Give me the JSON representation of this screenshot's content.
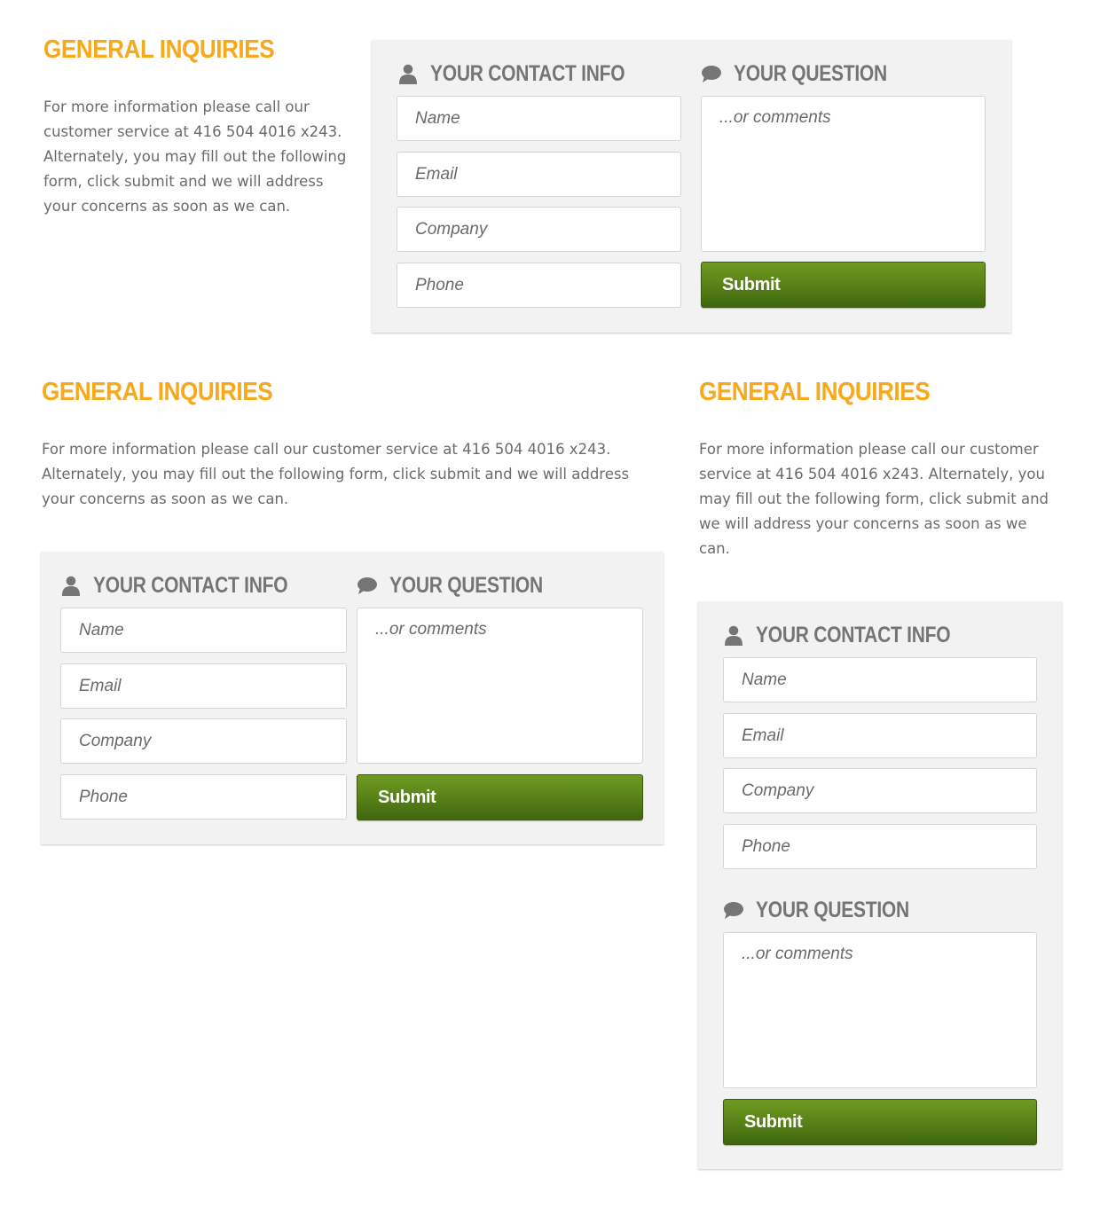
{
  "colors": {
    "heading": "#f7a81b",
    "body_text": "#6b6b6b",
    "section_title": "#757575",
    "panel_bg": "#f2f2f2",
    "submit_green": "#5b8519"
  },
  "heading": "GENERAL INQUIRIES",
  "intro": "For more information please call our customer service at 416 504 4016 x243. Alternately, you may fill out the following form, click submit and we will address your concerns as soon as we can.",
  "form": {
    "contact_title": "YOUR CONTACT INFO",
    "question_title": "YOUR QUESTION",
    "contact_icon": "user-icon",
    "question_icon": "speech-bubble-icon",
    "name_placeholder": "Name",
    "email_placeholder": "Email",
    "company_placeholder": "Company",
    "phone_placeholder": "Phone",
    "comments_placeholder": "...or comments",
    "submit_label": "Submit"
  }
}
